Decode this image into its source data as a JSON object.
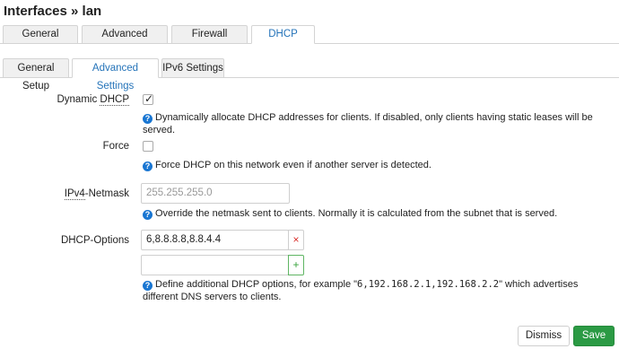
{
  "page_title": "Interfaces » lan",
  "top_tabs": [
    {
      "label": "General Settings"
    },
    {
      "label": "Advanced Settings"
    },
    {
      "label": "Firewall Settings"
    },
    {
      "label": "DHCP Server"
    }
  ],
  "sub_tabs": [
    {
      "label": "General Setup"
    },
    {
      "label": "Advanced Settings"
    },
    {
      "label": "IPv6 Settings"
    }
  ],
  "fields": {
    "dynamic_dhcp": {
      "label_prefix": "Dynamic ",
      "label_underlined": "DHCP",
      "checked": true,
      "hint": "Dynamically allocate DHCP addresses for clients. If disabled, only clients having static leases will be served."
    },
    "force": {
      "label": "Force",
      "checked": false,
      "hint": "Force DHCP on this network even if another server is detected."
    },
    "netmask": {
      "label_underlined": "IPv4",
      "label_suffix": "-Netmask",
      "placeholder": "255.255.255.0",
      "value": "",
      "hint": "Override the netmask sent to clients. Normally it is calculated from the subnet that is served."
    },
    "dhcp_options": {
      "label": "DHCP-Options",
      "values": [
        "6,8.8.8.8,8.8.4.4",
        ""
      ],
      "remove_symbol": "×",
      "add_symbol": "+",
      "hint_prefix": "Define additional DHCP options, for example \"",
      "hint_code": "6,192.168.2.1,192.168.2.2",
      "hint_suffix": "\" which advertises different DNS servers to clients."
    }
  },
  "buttons": {
    "dismiss": "Dismiss",
    "save": "Save"
  },
  "icons": {
    "help": "question-circle",
    "check": "✓"
  },
  "colors": {
    "accent": "#2473b9",
    "help_icon": "#1976d2",
    "remove": "#d9302c",
    "add": "#36a33b",
    "save": "#2b9a44"
  }
}
